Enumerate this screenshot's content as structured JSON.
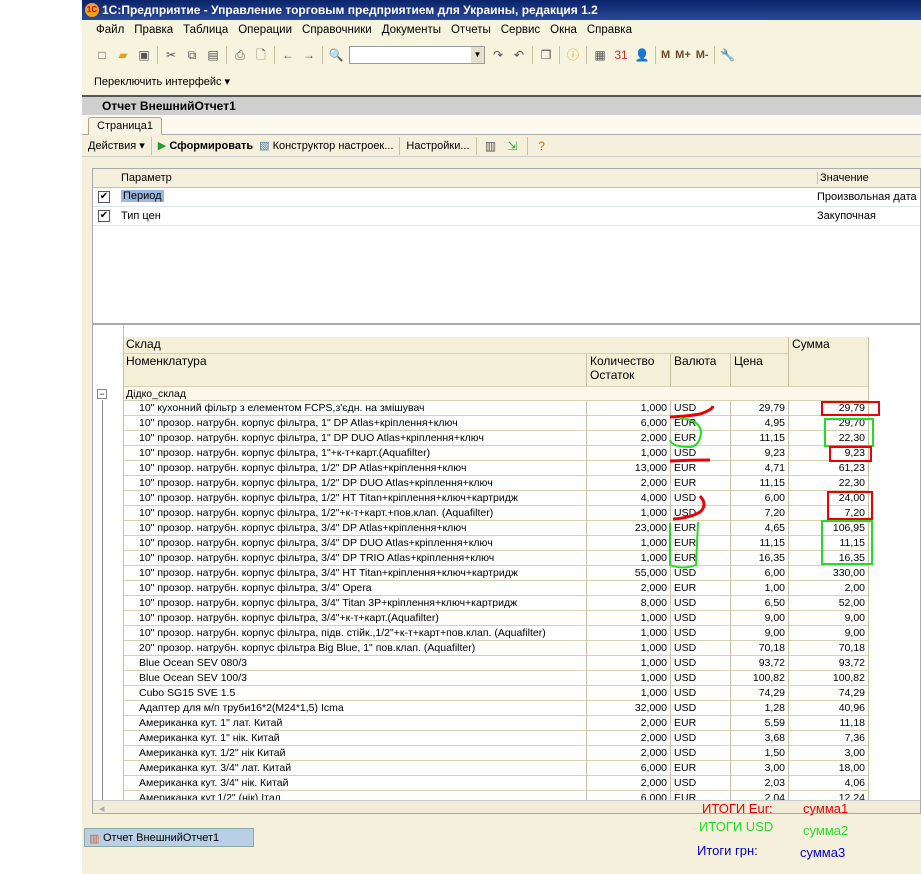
{
  "window": {
    "title": "1С:Предприятие - Управление торговым предприятием для Украины, редакция 1.2",
    "logo": "1С"
  },
  "menu": [
    "Файл",
    "Правка",
    "Таблица",
    "Операции",
    "Справочники",
    "Документы",
    "Отчеты",
    "Сервис",
    "Окна",
    "Справка"
  ],
  "toolbar": {
    "search_value": "",
    "memory": [
      "M",
      "M+",
      "M-"
    ],
    "switch_interface": "Переключить интерфейс ▾"
  },
  "doc": {
    "title": "Отчет  ВнешнийОтчет1",
    "tab": "Страница1"
  },
  "actions": {
    "actions_label": "Действия ▾",
    "generate": "Сформировать",
    "constructor": "Конструктор настроек...",
    "settings": "Настройки..."
  },
  "params": {
    "headers": {
      "param": "Параметр",
      "value": "Значение"
    },
    "rows": [
      {
        "name": "Период",
        "value": "Произвольная дата",
        "checked": true
      },
      {
        "name": "Тип цен",
        "value": "Закупочная",
        "checked": true
      }
    ]
  },
  "report": {
    "headers": {
      "warehouse": "Склад",
      "item": "Номенклатура",
      "qty": "Количество",
      "qty2": "Остаток",
      "currency": "Валюта",
      "price": "Цена",
      "sum": "Сумма"
    },
    "group": "Дідко_склад",
    "rows": [
      [
        "10\" кухонний фільтр з елементом FCPS,з'єдн. на змішувач",
        "1,000",
        "USD",
        "29,79",
        "29,79"
      ],
      [
        "10\" прозор. натрубн. корпус фільтра, 1\" DP Atlas+кріплення+ключ",
        "6,000",
        "EUR",
        "4,95",
        "29,70"
      ],
      [
        "10\" прозор. натрубн. корпус фільтра, 1\" DP DUO Atlas+кріплення+ключ",
        "2,000",
        "EUR",
        "11,15",
        "22,30"
      ],
      [
        "10\" прозор. натрубн. корпус фільтра, 1\"+к-т+карт.(Aquafilter)",
        "1,000",
        "USD",
        "9,23",
        "9,23"
      ],
      [
        "10\" прозор. натрубн. корпус фільтра, 1/2\" DP Atlas+кріплення+ключ",
        "13,000",
        "EUR",
        "4,71",
        "61,23"
      ],
      [
        "10\" прозор. натрубн. корпус фільтра, 1/2\" DP DUO Atlas+кріплення+ключ",
        "2,000",
        "EUR",
        "11,15",
        "22,30"
      ],
      [
        "10\" прозор. натрубн. корпус фільтра, 1/2\" HT Titan+кріплення+ключ+картридж",
        "4,000",
        "USD",
        "6,00",
        "24,00"
      ],
      [
        "10\" прозор. натрубн. корпус фільтра, 1/2\"+к-т+карт.+пов.клап. (Aquafilter)",
        "1,000",
        "USD",
        "7,20",
        "7,20"
      ],
      [
        "10\" прозор. натрубн. корпус фільтра, 3/4\" DP Atlas+кріплення+ключ",
        "23,000",
        "EUR",
        "4,65",
        "106,95"
      ],
      [
        "10\" прозор. натрубн. корпус фільтра, 3/4\" DP DUO Atlas+кріплення+ключ",
        "1,000",
        "EUR",
        "11,15",
        "11,15"
      ],
      [
        "10\" прозор. натрубн. корпус фільтра, 3/4\" DP TRIO Atlas+кріплення+ключ",
        "1,000",
        "EUR",
        "16,35",
        "16,35"
      ],
      [
        "10\" прозор. натрубн. корпус фільтра, 3/4\" HT Titan+кріплення+ключ+картридж",
        "55,000",
        "USD",
        "6,00",
        "330,00"
      ],
      [
        "10\" прозор. натрубн. корпус фільтра, 3/4\" Opera",
        "2,000",
        "EUR",
        "1,00",
        "2,00"
      ],
      [
        "10\" прозор. натрубн. корпус фільтра, 3/4\" Titan 3P+кріплення+ключ+картридж",
        "8,000",
        "USD",
        "6,50",
        "52,00"
      ],
      [
        "10\" прозор. натрубн. корпус фільтра, 3/4\"+к-т+карт.(Aquafilter)",
        "1,000",
        "USD",
        "9,00",
        "9,00"
      ],
      [
        "10\" прозор. натрубн. корпус фільтра, підв. стійк.,1/2\"+к-т+карт+пов.клап. (Aquafilter)",
        "1,000",
        "USD",
        "9,00",
        "9,00"
      ],
      [
        "20\" прозор. натрубн. корпус фільтра Big Blue, 1\" пов.клап. (Aquafilter)",
        "1,000",
        "USD",
        "70,18",
        "70,18"
      ],
      [
        "Blue Ocean SEV 080/3",
        "1,000",
        "USD",
        "93,72",
        "93,72"
      ],
      [
        "Blue Ocean SEV 100/3",
        "1,000",
        "USD",
        "100,82",
        "100,82"
      ],
      [
        "Cubo SG15 SVE 1.5",
        "1,000",
        "USD",
        "74,29",
        "74,29"
      ],
      [
        "Адаптер для м/п труби16*2(M24*1,5) Icma",
        "32,000",
        "USD",
        "1,28",
        "40,96"
      ],
      [
        "Американка кут. 1\" лат. Китай",
        "2,000",
        "EUR",
        "5,59",
        "11,18"
      ],
      [
        "Американка кут. 1\" нік. Китай",
        "2,000",
        "USD",
        "3,68",
        "7,36"
      ],
      [
        "Американка кут. 1/2\" нік Китай",
        "2,000",
        "USD",
        "1,50",
        "3,00"
      ],
      [
        "Американка кут. 3/4\" лат. Китай",
        "6,000",
        "EUR",
        "3,00",
        "18,00"
      ],
      [
        "Американка кут. 3/4\" нік. Китай",
        "2,000",
        "USD",
        "2,03",
        "4,06"
      ],
      [
        "Американка кут.1/2\" (нік) Італ",
        "6,000",
        "EUR",
        "2,04",
        "12,24"
      ]
    ]
  },
  "annotations": {
    "eur_label": "ИТОГИ Eur:",
    "eur_value": "сумма1",
    "usd_label": "ИТОГИ USD",
    "usd_value": "сумма2",
    "uah_label": "Итоги грн:",
    "uah_value": "сумма3",
    "colors": {
      "red": "#e00000",
      "green": "#22dd22",
      "blue": "#0000cc"
    }
  },
  "taskbar": {
    "item": "Отчет  ВнешнийОтчет1"
  }
}
